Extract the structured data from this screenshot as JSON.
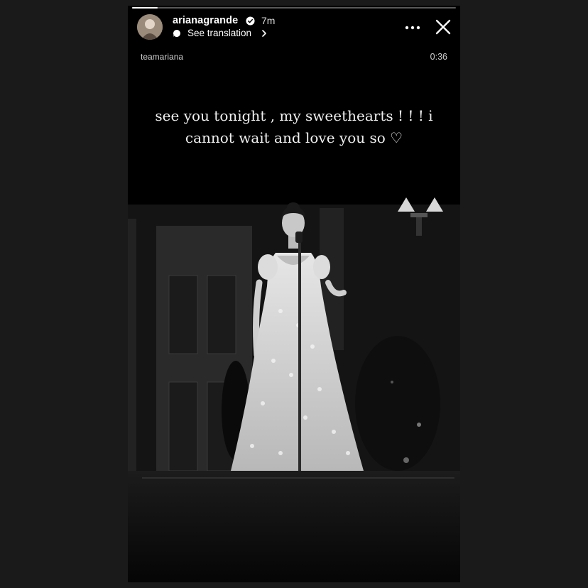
{
  "story": {
    "username": "arianagrande",
    "time_ago": "7m",
    "translation_label": "See translation",
    "account_tag": "teamariana",
    "duration": "0:36",
    "caption": "see you tonight , my sweethearts ! ! ! i cannot wait and love you so ♡",
    "progress": 0.08
  },
  "icons": {
    "verified": "verified-badge-icon",
    "translation": "translate-bubble-icon",
    "chevron": "chevron-right-icon",
    "more": "more-dots-icon",
    "close": "close-icon"
  },
  "colors": {
    "background": "#1a1a1a",
    "story_bg": "#000000",
    "verified_badge": "#ffffff"
  }
}
